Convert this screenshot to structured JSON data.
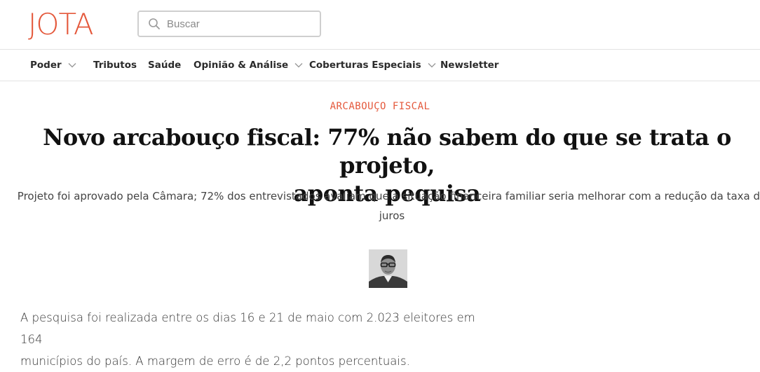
{
  "header": {
    "logo_text": "JOTA",
    "search": {
      "placeholder": "Buscar",
      "value": ""
    }
  },
  "nav": {
    "items": [
      {
        "label": "Poder",
        "has_dropdown": true
      },
      {
        "label": "Tributos",
        "has_dropdown": false
      },
      {
        "label": "Saúde",
        "has_dropdown": false
      },
      {
        "label": "Opinião & Análise",
        "has_dropdown": true
      },
      {
        "label": "Coberturas Especiais",
        "has_dropdown": true
      },
      {
        "label": "Newsletter",
        "has_dropdown": false
      }
    ]
  },
  "article": {
    "kicker": "ARCABOUÇO FISCAL",
    "headline_line1": "Novo arcabouço fiscal: 77% não sabem do que se trata o projeto,",
    "headline_line2": "aponta pequisa",
    "subtitle": "Projeto foi aprovado pela Câmara; 72% dos entrevistados avaliam que a situação financeira familiar seria melhorar com a redução da taxa de juros",
    "body_line1": "A pesquisa foi realizada entre os dias 16 e 21 de maio com 2.023 eleitores em 164",
    "body_line2": "municípios do país. A margem de erro é de 2,2 pontos percentuais."
  },
  "colors": {
    "brand": "#e4583b",
    "text": "#222222",
    "border": "#e3e3e3"
  },
  "icons": {
    "search": "search-icon",
    "dropdown": "chevron-down-icon"
  }
}
